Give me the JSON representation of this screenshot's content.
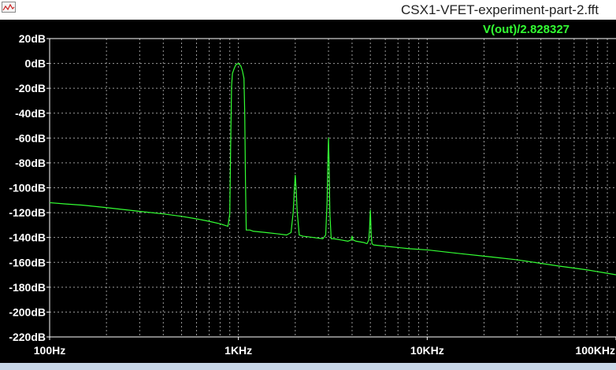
{
  "window": {
    "title": "CSX1-VFET-experiment-part-2.fft",
    "icon": "ltspice-app-icon"
  },
  "colors": {
    "background": "#000000",
    "grid": "#9a9a9a",
    "trace": "#33ff33",
    "axis_text": "#ffffff"
  },
  "chart_data": {
    "type": "line",
    "title": "",
    "xlabel": "",
    "ylabel": "",
    "x_scale": "log",
    "xlim": [
      100,
      100000
    ],
    "ylim": [
      -220,
      20
    ],
    "grid": true,
    "legend_position": "top-right",
    "x_ticks": [
      100,
      1000,
      10000,
      100000
    ],
    "x_tick_labels": [
      "100Hz",
      "1KHz",
      "10KHz",
      "100KHz"
    ],
    "y_ticks": [
      20,
      0,
      -20,
      -40,
      -60,
      -80,
      -100,
      -120,
      -140,
      -160,
      -180,
      -200,
      -220
    ],
    "y_tick_labels": [
      "20dB",
      "0dB",
      "-20dB",
      "-40dB",
      "-60dB",
      "-80dB",
      "-100dB",
      "-120dB",
      "-140dB",
      "-160dB",
      "-180dB",
      "-200dB",
      "-220dB"
    ],
    "series": [
      {
        "name": "V(out)/2.828327",
        "x": [
          100,
          120,
          150,
          200,
          300,
          400,
          500,
          600,
          700,
          800,
          880,
          900,
          910,
          920,
          930,
          950,
          970,
          1000,
          1030,
          1050,
          1070,
          1080,
          1090,
          1100,
          1150,
          1200,
          1400,
          1600,
          1800,
          1900,
          1950,
          1980,
          2000,
          2020,
          2050,
          2100,
          2200,
          2500,
          2800,
          2900,
          2950,
          2980,
          3000,
          3020,
          3050,
          3100,
          3200,
          3500,
          3800,
          3950,
          4000,
          4050,
          4200,
          4600,
          4800,
          4900,
          4950,
          4980,
          5000,
          5020,
          5050,
          5100,
          5200,
          6000,
          8000,
          10000,
          15000,
          20000,
          30000,
          50000,
          70000,
          100000
        ],
        "y": [
          -112,
          -113,
          -114,
          -116,
          -119,
          -121,
          -123,
          -125,
          -127,
          -129,
          -131,
          -121,
          -65,
          -18,
          -8,
          -4,
          -1,
          0,
          -2,
          -6,
          -12,
          -40,
          -95,
          -134,
          -134,
          -135,
          -136,
          -137,
          -138,
          -136,
          -120,
          -100,
          -90,
          -100,
          -120,
          -138,
          -139,
          -140,
          -141,
          -138,
          -110,
          -75,
          -60,
          -78,
          -120,
          -141,
          -141,
          -142,
          -143,
          -142,
          -139,
          -142,
          -143,
          -144,
          -145,
          -142,
          -133,
          -123,
          -118,
          -125,
          -138,
          -145,
          -146,
          -147,
          -149,
          -150,
          -153,
          -155,
          -158,
          -163,
          -166,
          -170
        ]
      }
    ]
  }
}
